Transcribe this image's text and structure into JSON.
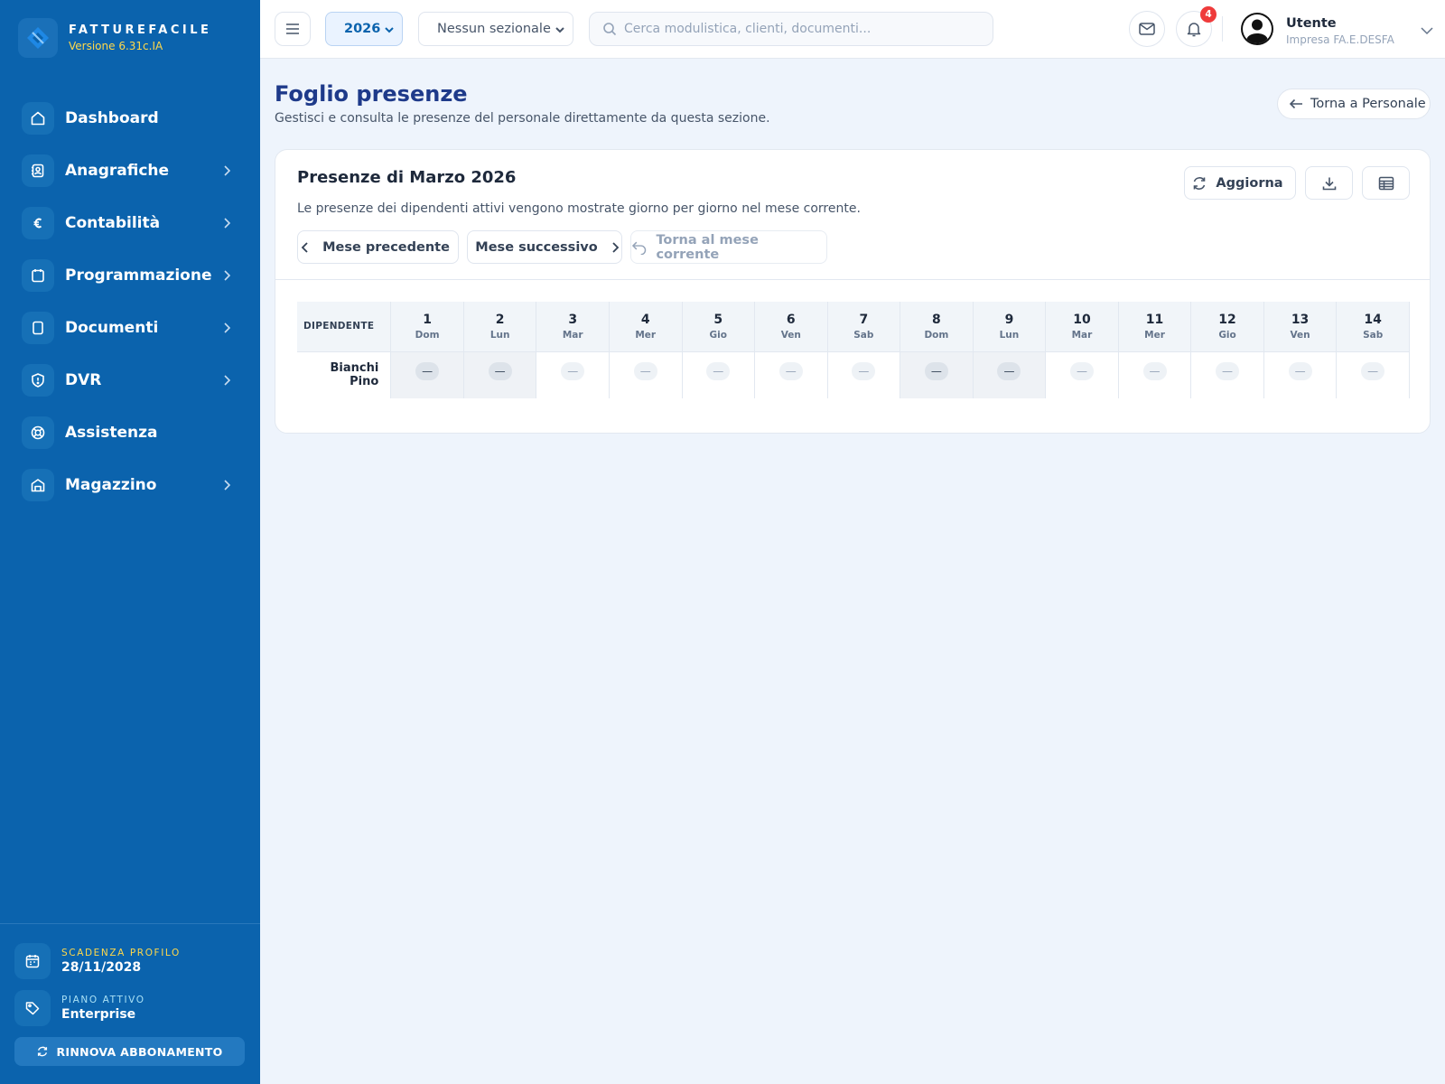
{
  "brand": {
    "name": "FATTUREFACILE",
    "version": "Versione 6.31c.IA"
  },
  "sidebar": {
    "items": [
      {
        "label": "Dashboard",
        "icon": "home-icon",
        "has_chevron": false
      },
      {
        "label": "Anagrafiche",
        "icon": "contacts-icon",
        "has_chevron": true
      },
      {
        "label": "Contabilità",
        "icon": "euro-icon",
        "has_chevron": true
      },
      {
        "label": "Programmazione",
        "icon": "calendar-icon",
        "has_chevron": true
      },
      {
        "label": "Documenti",
        "icon": "document-icon",
        "has_chevron": true
      },
      {
        "label": "DVR",
        "icon": "shield-icon",
        "has_chevron": true
      },
      {
        "label": "Assistenza",
        "icon": "lifebuoy-icon",
        "has_chevron": false
      },
      {
        "label": "Magazzino",
        "icon": "warehouse-icon",
        "has_chevron": true
      }
    ],
    "expiry": {
      "label": "SCADENZA PROFILO",
      "value": "28/11/2028"
    },
    "plan": {
      "label": "PIANO ATTIVO",
      "value": "Enterprise"
    },
    "renew_label": "RINNOVA ABBONAMENTO"
  },
  "topbar": {
    "year": "2026",
    "sezionale": "Nessun sezionale",
    "search_placeholder": "Cerca modulistica, clienti, documenti...",
    "notifications_count": "4",
    "user": {
      "name": "Utente",
      "company": "Impresa FA.E.DESFA"
    }
  },
  "page": {
    "title": "Foglio presenze",
    "subtitle": "Gestisci e consulta le presenze del personale direttamente da questa sezione.",
    "back_label": "Torna a Personale"
  },
  "card": {
    "title": "Presenze di Marzo 2026",
    "description": "Le presenze dei dipendenti attivi vengono mostrate giorno per giorno nel mese corrente.",
    "refresh_label": "Aggiorna",
    "prev_label": "Mese precedente",
    "next_label": "Mese successivo",
    "current_label": "Torna al mese corrente"
  },
  "attendance": {
    "employee_header": "DIPENDENTE",
    "days": [
      {
        "num": "1",
        "wd": "Dom",
        "weekend": true
      },
      {
        "num": "2",
        "wd": "Lun",
        "weekend": true
      },
      {
        "num": "3",
        "wd": "Mar",
        "weekend": false
      },
      {
        "num": "4",
        "wd": "Mer",
        "weekend": false
      },
      {
        "num": "5",
        "wd": "Gio",
        "weekend": false
      },
      {
        "num": "6",
        "wd": "Ven",
        "weekend": false
      },
      {
        "num": "7",
        "wd": "Sab",
        "weekend": false
      },
      {
        "num": "8",
        "wd": "Dom",
        "weekend": true
      },
      {
        "num": "9",
        "wd": "Lun",
        "weekend": true
      },
      {
        "num": "10",
        "wd": "Mar",
        "weekend": false
      },
      {
        "num": "11",
        "wd": "Mer",
        "weekend": false
      },
      {
        "num": "12",
        "wd": "Gio",
        "weekend": false
      },
      {
        "num": "13",
        "wd": "Ven",
        "weekend": false
      },
      {
        "num": "14",
        "wd": "Sab",
        "weekend": false
      }
    ],
    "rows": [
      {
        "employee": "Bianchi Pino",
        "marks": [
          "—",
          "—",
          "—",
          "—",
          "—",
          "—",
          "—",
          "—",
          "—",
          "—",
          "—",
          "—",
          "—",
          "—"
        ]
      }
    ]
  }
}
